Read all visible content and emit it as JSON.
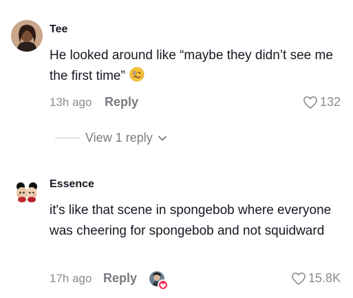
{
  "comments": [
    {
      "username": "Tee",
      "text": "He looked around like “maybe they didn’t see me the first time”",
      "emoji_icon": "woozy-face-emoji",
      "time": "13h ago",
      "reply_label": "Reply",
      "likes": "132"
    },
    {
      "username": "Essence",
      "text": "it's like that scene in spongebob where everyone was cheering for spongebob and not squidward",
      "time": "17h ago",
      "reply_label": "Reply",
      "likes": "15.8K",
      "creator_liked": true
    }
  ],
  "view_replies_label": "View 1 reply",
  "colors": {
    "text": "#161823",
    "muted": "#8a8b91",
    "accent": "#fe2c55"
  }
}
